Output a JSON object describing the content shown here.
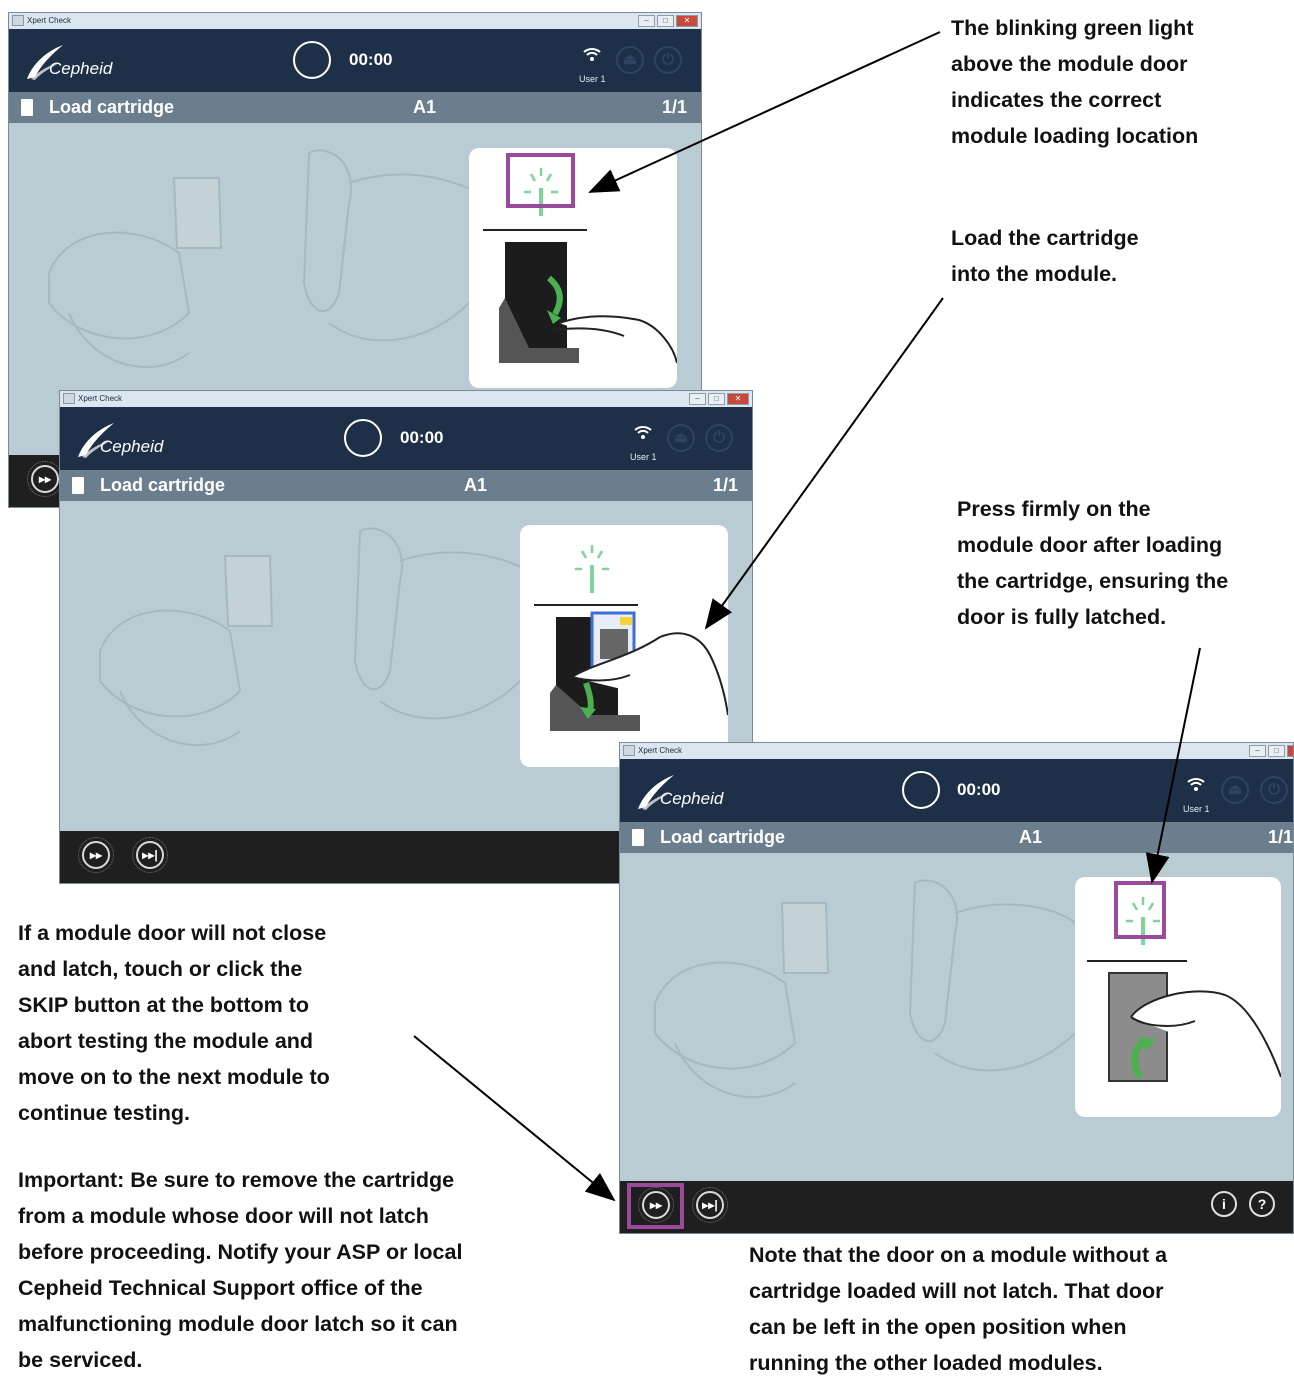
{
  "window": {
    "app_title": "Xpert Check",
    "logo_text": "Cepheid",
    "timer": "00:00",
    "user_label": "User 1",
    "step_title": "Load cartridge",
    "slot": "A1",
    "step_count": "1/1",
    "info_label": "i",
    "help_label": "?"
  },
  "annotations": {
    "blinking_light": "The blinking green light\nabove the module door\nindicates the correct\nmodule loading location",
    "load_cartridge": "Load the cartridge\ninto the module.",
    "press_firmly": "Press firmly on the\nmodule door after loading\nthe cartridge, ensuring the\ndoor is fully latched.",
    "skip_info": "If a module door will not close\nand latch, touch or click the\nSKIP button at the bottom to\nabort testing the module and\nmove on to the next module to\ncontinue testing.",
    "important": "Important: Be sure to remove the cartridge\nfrom a module whose door will not latch\nbefore proceeding. Notify your ASP or local\nCepheid Technical Support office of the\nmalfunctioning module door latch so it can\nbe serviced.",
    "note_latch": "Note that the door on a module without a\ncartridge loaded will not latch. That door\ncan be left in the open position when\nrunning the other loaded modules."
  },
  "icons": [
    "app-icon",
    "cepheid-logo-icon",
    "timer-circle-icon",
    "wifi-icon",
    "cartridge-icon",
    "skip-icon",
    "skip-all-icon",
    "info-icon",
    "help-icon",
    "green-light-icon",
    "green-arrow-icon"
  ],
  "colors": {
    "header": "#1e3048",
    "step_bar": "#6b7e8e",
    "content": "#b9ccd3",
    "footer": "#1f1f1f",
    "highlight": "#9b4a9b",
    "green_light": "#7fd49a"
  }
}
